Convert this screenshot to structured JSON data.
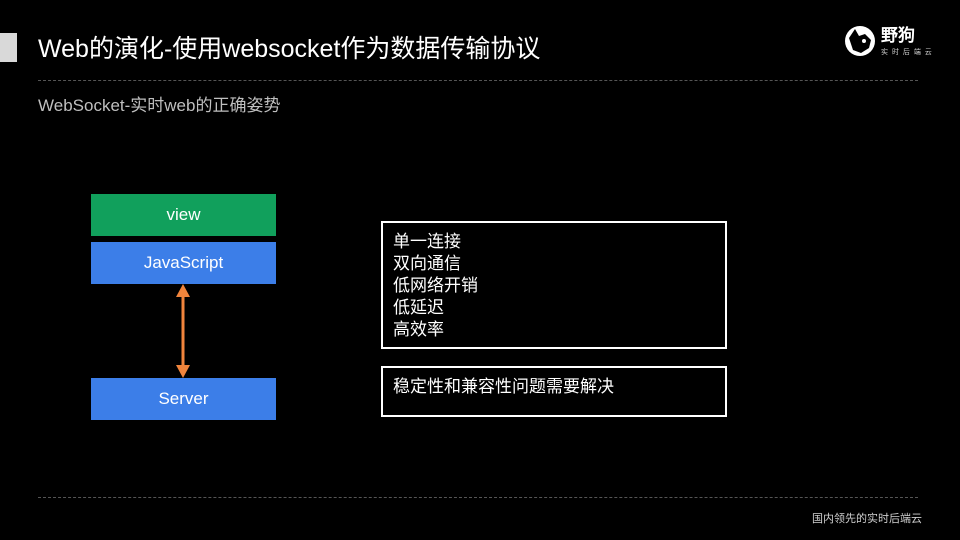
{
  "slide": {
    "title": "Web的演化-使用websocket作为数据传输协议",
    "subtitle": "WebSocket-实时web的正确姿势",
    "footer": "国内领先的实时后端云"
  },
  "brand": {
    "logo_icon": "dog-head-icon",
    "name": "野狗",
    "tagline": "实 时 后 端 云"
  },
  "diagram": {
    "view_label": "view",
    "javascript_label": "JavaScript",
    "server_label": "Server",
    "connector_icon": "double-headed-arrow-icon",
    "colors": {
      "view": "#11a05c",
      "javascript": "#3c7ee8",
      "server": "#3c7ee8",
      "arrow": "#f0843c"
    }
  },
  "features": [
    "单一连接",
    "双向通信",
    "低网络开销",
    "低延迟",
    "高效率"
  ],
  "issue": "稳定性和兼容性问题需要解决"
}
